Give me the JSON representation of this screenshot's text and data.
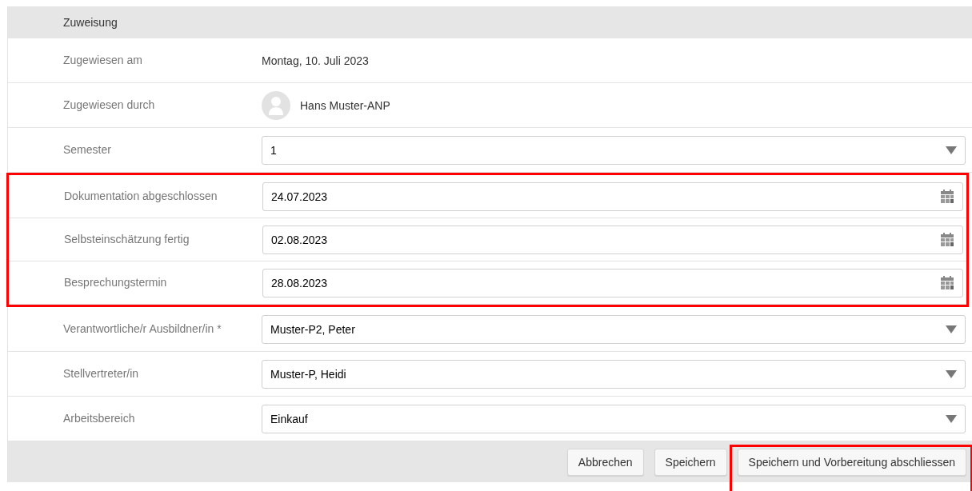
{
  "section": {
    "title": "Zuweisung"
  },
  "rows": [
    {
      "label": "Zugewiesen am",
      "kind": "text",
      "value": "Montag, 10. Juli 2023",
      "highlighted": false
    },
    {
      "label": "Zugewiesen durch",
      "kind": "user",
      "value": "Hans Muster-ANP",
      "highlighted": false
    },
    {
      "label": "Semester",
      "kind": "select",
      "value": "1",
      "highlighted": false
    },
    {
      "label": "Dokumentation abgeschlossen",
      "kind": "date",
      "value": "24.07.2023",
      "highlighted": true
    },
    {
      "label": "Selbsteinschätzung fertig",
      "kind": "date",
      "value": "02.08.2023",
      "highlighted": true
    },
    {
      "label": "Besprechungstermin",
      "kind": "date",
      "value": "28.08.2023",
      "highlighted": true
    },
    {
      "label": "Verantwortliche/r Ausbildner/in *",
      "kind": "select",
      "value": "Muster-P2, Peter",
      "highlighted": false
    },
    {
      "label": "Stellvertreter/in",
      "kind": "select",
      "value": "Muster-P, Heidi",
      "highlighted": false
    },
    {
      "label": "Arbeitsbereich",
      "kind": "select",
      "value": "Einkauf",
      "highlighted": false
    }
  ],
  "buttons": [
    {
      "label": "Abbrechen",
      "highlighted": false
    },
    {
      "label": "Speichern",
      "highlighted": false
    },
    {
      "label": "Speichern und Vorbereitung abschliessen",
      "highlighted": true
    }
  ]
}
